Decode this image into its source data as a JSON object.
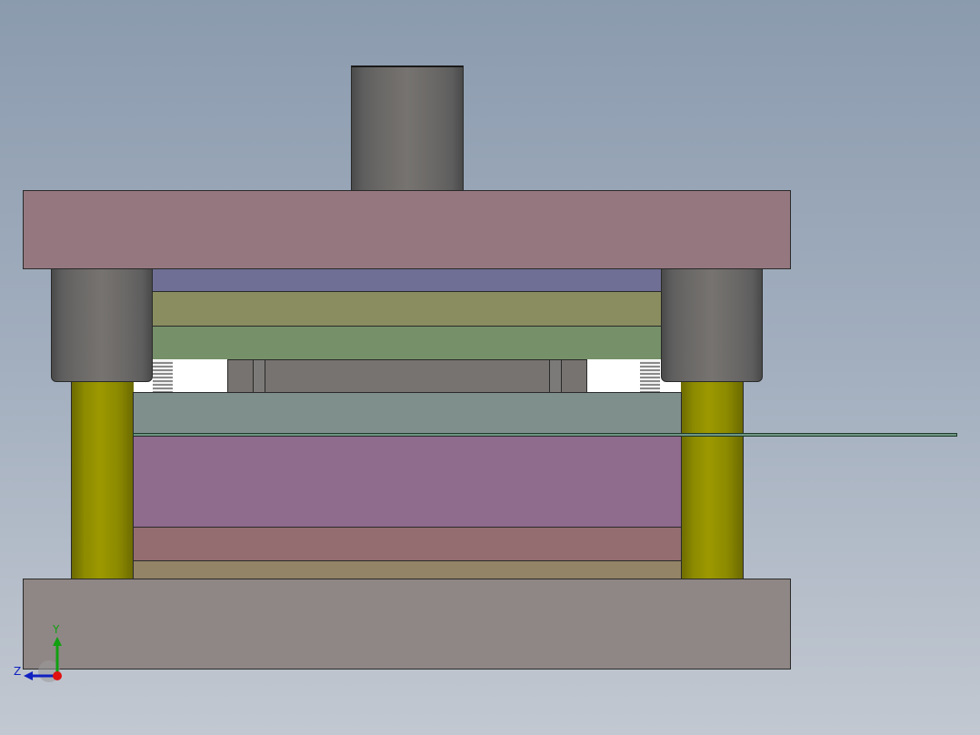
{
  "viewport": {
    "background": "sky-gradient"
  },
  "parts": {
    "shank": {
      "color": "#767370"
    },
    "top_plate": {
      "color": "#95777f"
    },
    "backing_plate": {
      "color": "#6f6f95"
    },
    "punch_holder_plate": {
      "color": "#8a8d5f"
    },
    "stripper_backing": {
      "color": "#76906a"
    },
    "stripper_plate": {
      "color": "#7f8f8c"
    },
    "strip": {
      "color": "#6e9682"
    },
    "die_plate": {
      "color": "#8f6b8d"
    },
    "die_backing": {
      "color": "#936d6f"
    },
    "die_shim": {
      "color": "#938467"
    },
    "bottom_plate": {
      "color": "#8f8785"
    },
    "guide_bushing": {
      "color": "#767370"
    },
    "guide_pillar": {
      "color": "#9c9900"
    }
  },
  "triad": {
    "x_label": "",
    "y_label": "Y",
    "z_label": "Z",
    "x_color": "#e01010",
    "y_color": "#10a010",
    "z_color": "#1020c0"
  }
}
